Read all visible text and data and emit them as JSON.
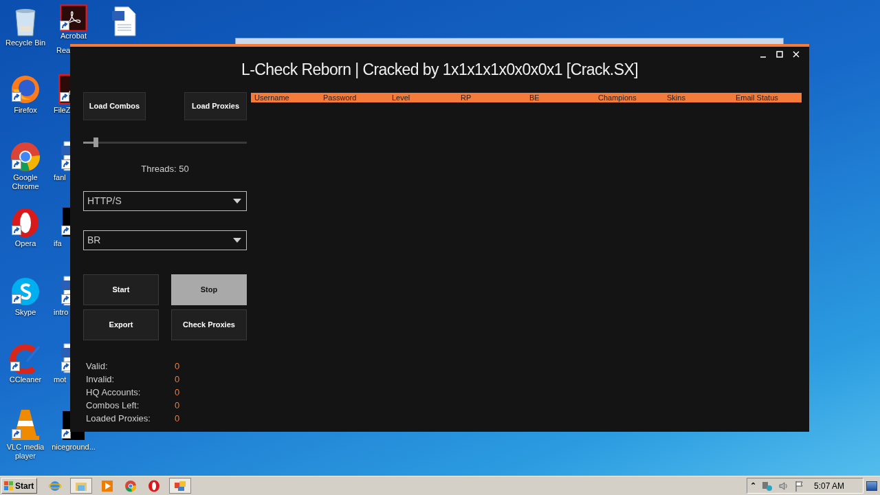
{
  "desktop": {
    "icons": [
      {
        "kind": "recycle-bin",
        "lines": [
          "Recycle Bin"
        ]
      },
      {
        "kind": "firefox",
        "lines": [
          "Firefox"
        ]
      },
      {
        "kind": "chrome",
        "lines": [
          "Google",
          "Chrome"
        ]
      },
      {
        "kind": "opera",
        "lines": [
          "Opera"
        ]
      },
      {
        "kind": "skype",
        "lines": [
          "Skype"
        ]
      },
      {
        "kind": "ccleaner",
        "lines": [
          "CCleaner"
        ]
      },
      {
        "kind": "vlc",
        "lines": [
          "VLC media",
          "player"
        ]
      },
      {
        "kind": "pdf",
        "lines": [
          "Acrobat",
          "Rea"
        ]
      },
      {
        "kind": "pdf",
        "lines": [
          "FileZ"
        ]
      },
      {
        "kind": "document",
        "lines": [
          "fanl"
        ]
      },
      {
        "kind": "blank",
        "lines": [
          "ifa"
        ]
      },
      {
        "kind": "document",
        "lines": [
          "intro"
        ]
      },
      {
        "kind": "document",
        "lines": [
          "mot"
        ]
      },
      {
        "kind": "blank",
        "lines": [
          "niceground..."
        ]
      },
      {
        "kind": "document"
      }
    ]
  },
  "window": {
    "title": "L-Check Reborn | Cracked by 1x1x1x1x0x0x0x1 [Crack.SX]",
    "load_buttons": [
      "Load Combos",
      "Load Proxies"
    ],
    "threads": {
      "level": 0.075,
      "label": "Threads: 50"
    },
    "dropdowns": [
      {
        "value": "HTTP/S"
      },
      {
        "value": "BR"
      }
    ],
    "actions": [
      {
        "label": "Start",
        "selected": false
      },
      {
        "label": "Stop",
        "selected": true
      },
      {
        "label": "Export",
        "selected": false
      },
      {
        "label": "Check Proxies",
        "selected": false
      }
    ],
    "stats": [
      {
        "label": "Valid:",
        "value": "0"
      },
      {
        "label": "Invalid:",
        "value": "0"
      },
      {
        "label": "HQ Accounts:",
        "value": "0"
      },
      {
        "label": "Combos Left:",
        "value": "0"
      },
      {
        "label": "Loaded Proxies:",
        "value": "0"
      }
    ],
    "table": {
      "columns": [
        "Username",
        "Password",
        "Level",
        "RP",
        "BE",
        "Champions",
        "Skins",
        "Email Status"
      ]
    }
  },
  "taskbar": {
    "start": "Start",
    "apps": [
      {
        "kind": "ie",
        "selected": false
      },
      {
        "kind": "folder",
        "selected": true
      },
      {
        "kind": "media",
        "selected": false
      },
      {
        "kind": "chrome",
        "selected": false
      },
      {
        "kind": "opera",
        "selected": false
      },
      {
        "kind": "app",
        "selected": true
      }
    ],
    "tray_arrow": "⌃",
    "clock": "5:07 AM"
  }
}
